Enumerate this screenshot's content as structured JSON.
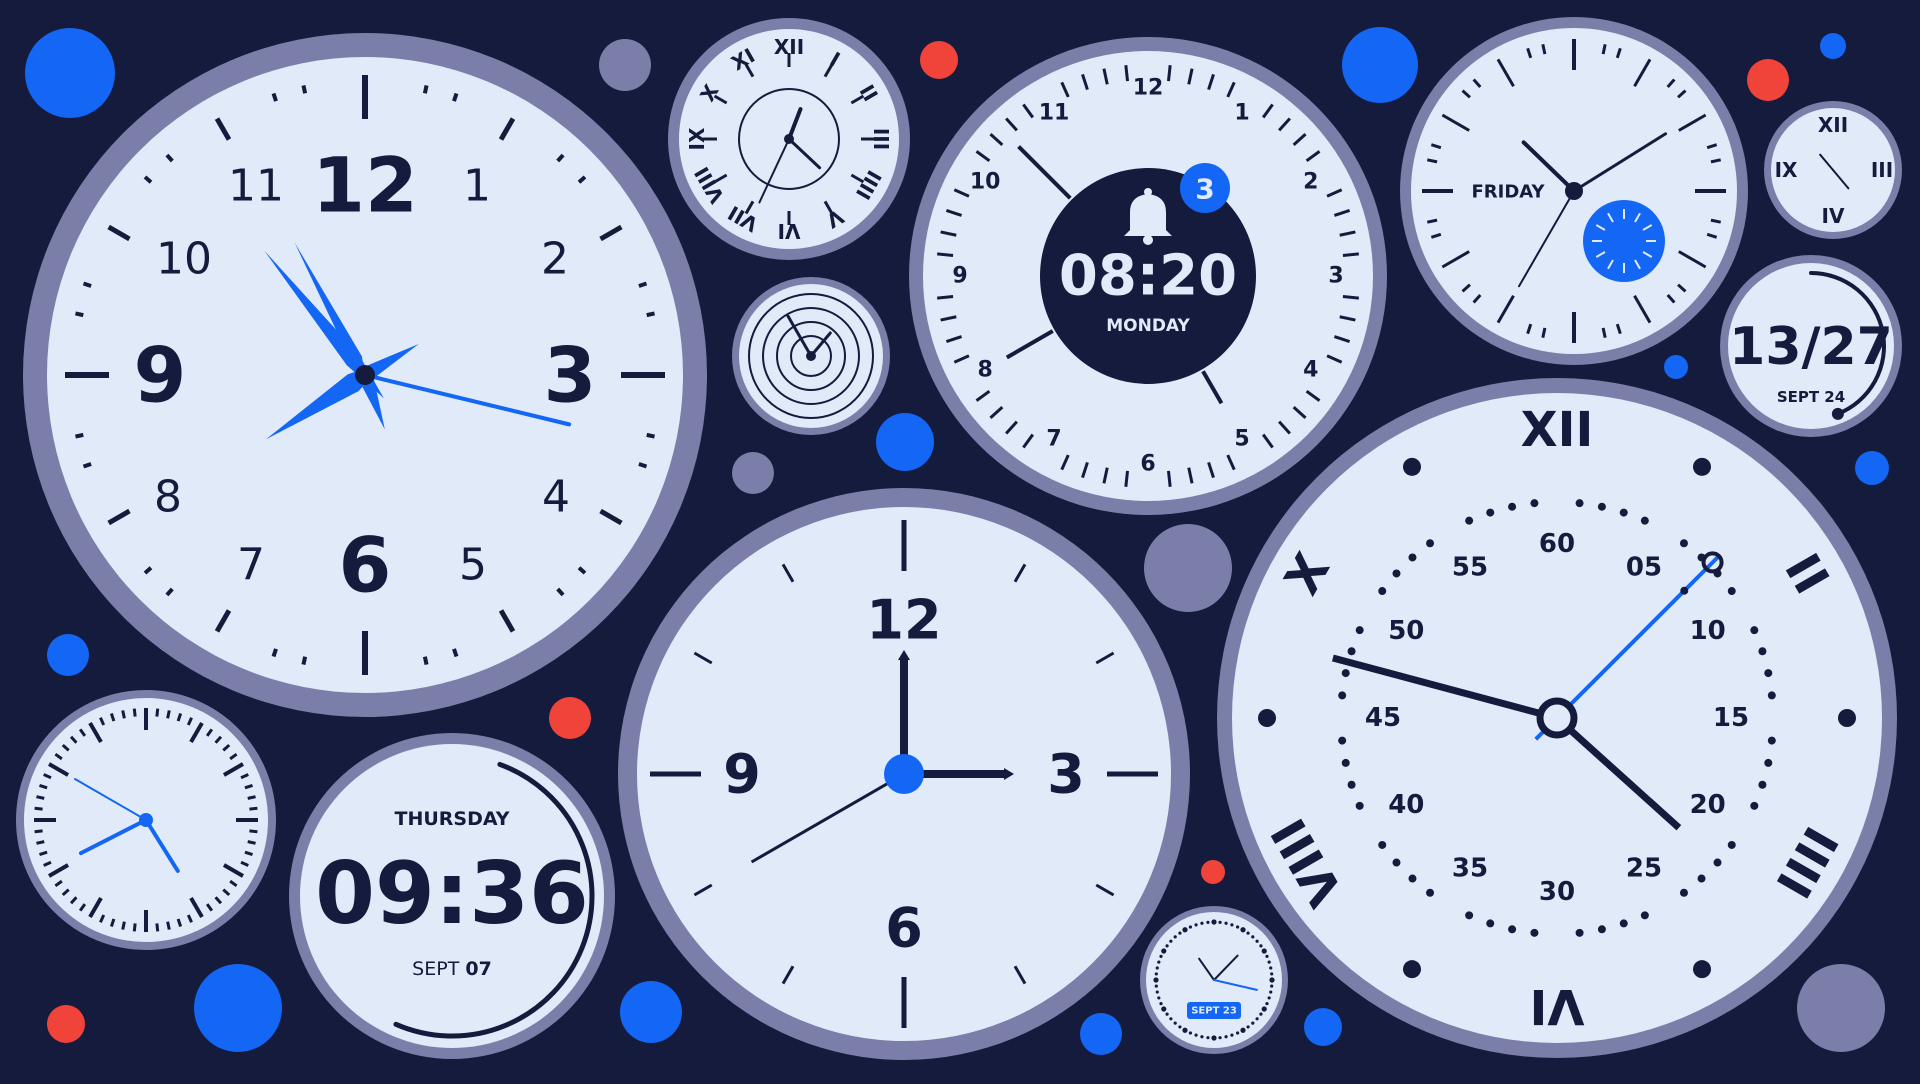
{
  "colors": {
    "background": "#141b3c",
    "face": "#e1eaf9",
    "rim": "#7b7ea8",
    "ink": "#141b3c",
    "accent": "#1466f5",
    "red": "#f0443a",
    "dot_gray": "#7b7ea8"
  },
  "clocks": {
    "big_serif": {
      "numerals": [
        "12",
        "1",
        "2",
        "3",
        "4",
        "5",
        "6",
        "7",
        "8",
        "9",
        "10",
        "11"
      ],
      "time": {
        "hours": 7.9,
        "minutes": 53.5,
        "seconds": 16.2
      }
    },
    "roman_small": {
      "numerals": [
        "XII",
        "I",
        "II",
        "III",
        "IIII",
        "V",
        "VI",
        "VII",
        "VIII",
        "IX",
        "X",
        "XI"
      ],
      "time": {
        "hours": 0.7,
        "minutes": 22.2,
        "seconds": 34.3
      }
    },
    "rings": {
      "time": {
        "hours": 10.2,
        "minutes": 4
      }
    },
    "alarm": {
      "numerals": [
        "12",
        "1",
        "2",
        "3",
        "4",
        "5",
        "6",
        "7",
        "8",
        "9",
        "10",
        "11"
      ],
      "time_text": "08:20",
      "day_text": "MONDAY",
      "badge_count": "3",
      "icon": "bell-icon"
    },
    "friday": {
      "day_text": "FRIDAY",
      "time": {
        "hours": 10.5,
        "minutes": 12.3,
        "seconds": 35.7
      }
    },
    "roman_tiny": {
      "numerals": [
        "XII",
        "III",
        "IV",
        "IX"
      ],
      "time": {
        "hours": 3.6,
        "minutes": 52.5
      }
    },
    "date_ring": {
      "main_text": "13/27",
      "date_text": "SEPT 24",
      "progress": 0.2
    },
    "minute_dial": {
      "time": {
        "hours": 9.7,
        "minutes": 21.7,
        "seconds": 7.5
      },
      "minute_labels": [
        "60",
        "05",
        "10",
        "15",
        "20",
        "25",
        "30",
        "35",
        "40",
        "45",
        "50",
        "55"
      ],
      "numerals": [
        "XII",
        "II",
        "IIII",
        "VI",
        "VIII",
        "X"
      ],
      "numeral_hours": [
        0,
        2,
        4,
        6,
        8,
        10
      ]
    },
    "bold_sans": {
      "numerals": [
        "12",
        "3",
        "6",
        "9"
      ],
      "time": {
        "hours": 3,
        "minutes": 40
      }
    },
    "small_ticks": {
      "time": {
        "hours": 4.35,
        "minutes": 50.8,
        "seconds": 16.2
      }
    },
    "digital": {
      "day_text": "THURSDAY",
      "time_text": "09:36",
      "date_month": "SEPT",
      "date_day": "07",
      "progress": 0.6
    },
    "tiny_date": {
      "time": {
        "hours": 10.8,
        "minutes": 24.2
      },
      "badge_text": "SEPT 23"
    }
  }
}
